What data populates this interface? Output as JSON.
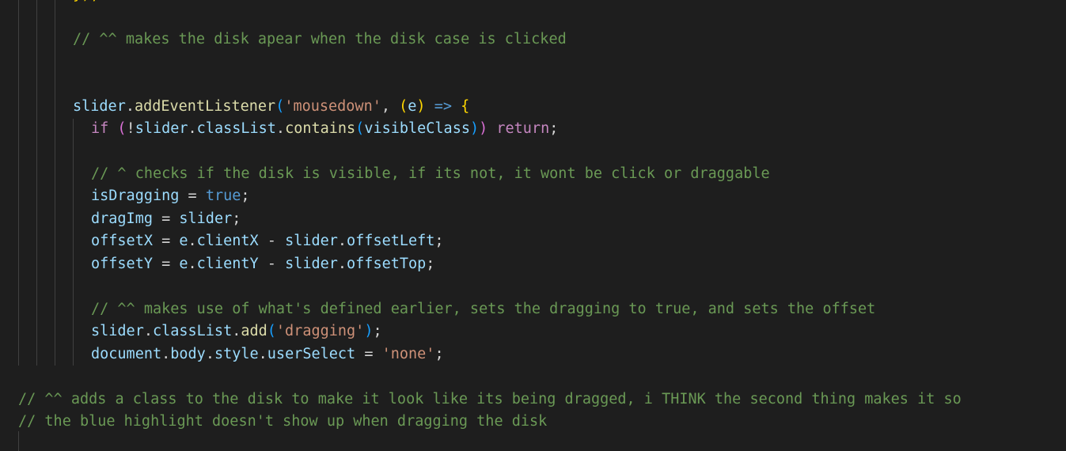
{
  "code": {
    "top_fragment": "});",
    "comment_disk_appear": "// ^^ makes the disk apear when the disk case is clicked",
    "listener": {
      "obj": "slider",
      "dot": ".",
      "method": "addEventListener",
      "open": "(",
      "event": "'mousedown'",
      "comma": ", ",
      "param_open": "(",
      "param": "e",
      "param_close": ")",
      "arrow": " => ",
      "brace": "{"
    },
    "if_line": {
      "kw": "if",
      "space": " ",
      "open": "(",
      "not": "!",
      "obj": "slider",
      "dot1": ".",
      "prop": "classList",
      "dot2": ".",
      "method": "contains",
      "inner_open": "(",
      "arg": "visibleClass",
      "inner_close": ")",
      "close": ")",
      "ret": " return",
      "semi": ";"
    },
    "comment_checks": "// ^ checks if the disk is visible, if its not, it wont be click or draggable",
    "is_dragging": {
      "name": "isDragging",
      "eq": " = ",
      "val": "true",
      "semi": ";"
    },
    "drag_img": {
      "name": "dragImg",
      "eq": " = ",
      "val": "slider",
      "semi": ";"
    },
    "offset_x": {
      "name": "offsetX",
      "eq": " = ",
      "e": "e",
      "dot": ".",
      "prop": "clientX",
      "minus": " - ",
      "obj": "slider",
      "dot2": ".",
      "prop2": "offsetLeft",
      "semi": ";"
    },
    "offset_y": {
      "name": "offsetY",
      "eq": " = ",
      "e": "e",
      "dot": ".",
      "prop": "clientY",
      "minus": " - ",
      "obj": "slider",
      "dot2": ".",
      "prop2": "offsetTop",
      "semi": ";"
    },
    "comment_makes_use": "// ^^ makes use of what's defined earlier, sets the dragging to true, and sets the offset",
    "class_add": {
      "obj": "slider",
      "dot": ".",
      "prop": "classList",
      "dot2": ".",
      "method": "add",
      "open": "(",
      "arg": "'dragging'",
      "close": ")",
      "semi": ";"
    },
    "user_select": {
      "obj": "document",
      "dot": ".",
      "prop1": "body",
      "dot2": ".",
      "prop2": "style",
      "dot3": ".",
      "prop3": "userSelect",
      "eq": " = ",
      "val": "'none'",
      "semi": ";"
    },
    "comment_adds_class_1": "// ^^ adds a class to the disk to make it look like its being dragged, i THINK the second thing makes it so",
    "comment_adds_class_2": "// the blue highlight doesn't show up when dragging the disk"
  },
  "colors": {
    "background": "#1e1e1e",
    "comment": "#6a9955",
    "variable": "#9cdcfe",
    "function": "#dcdcaa",
    "string": "#ce9178",
    "keyword": "#c586c0",
    "boolean": "#569cd6"
  }
}
